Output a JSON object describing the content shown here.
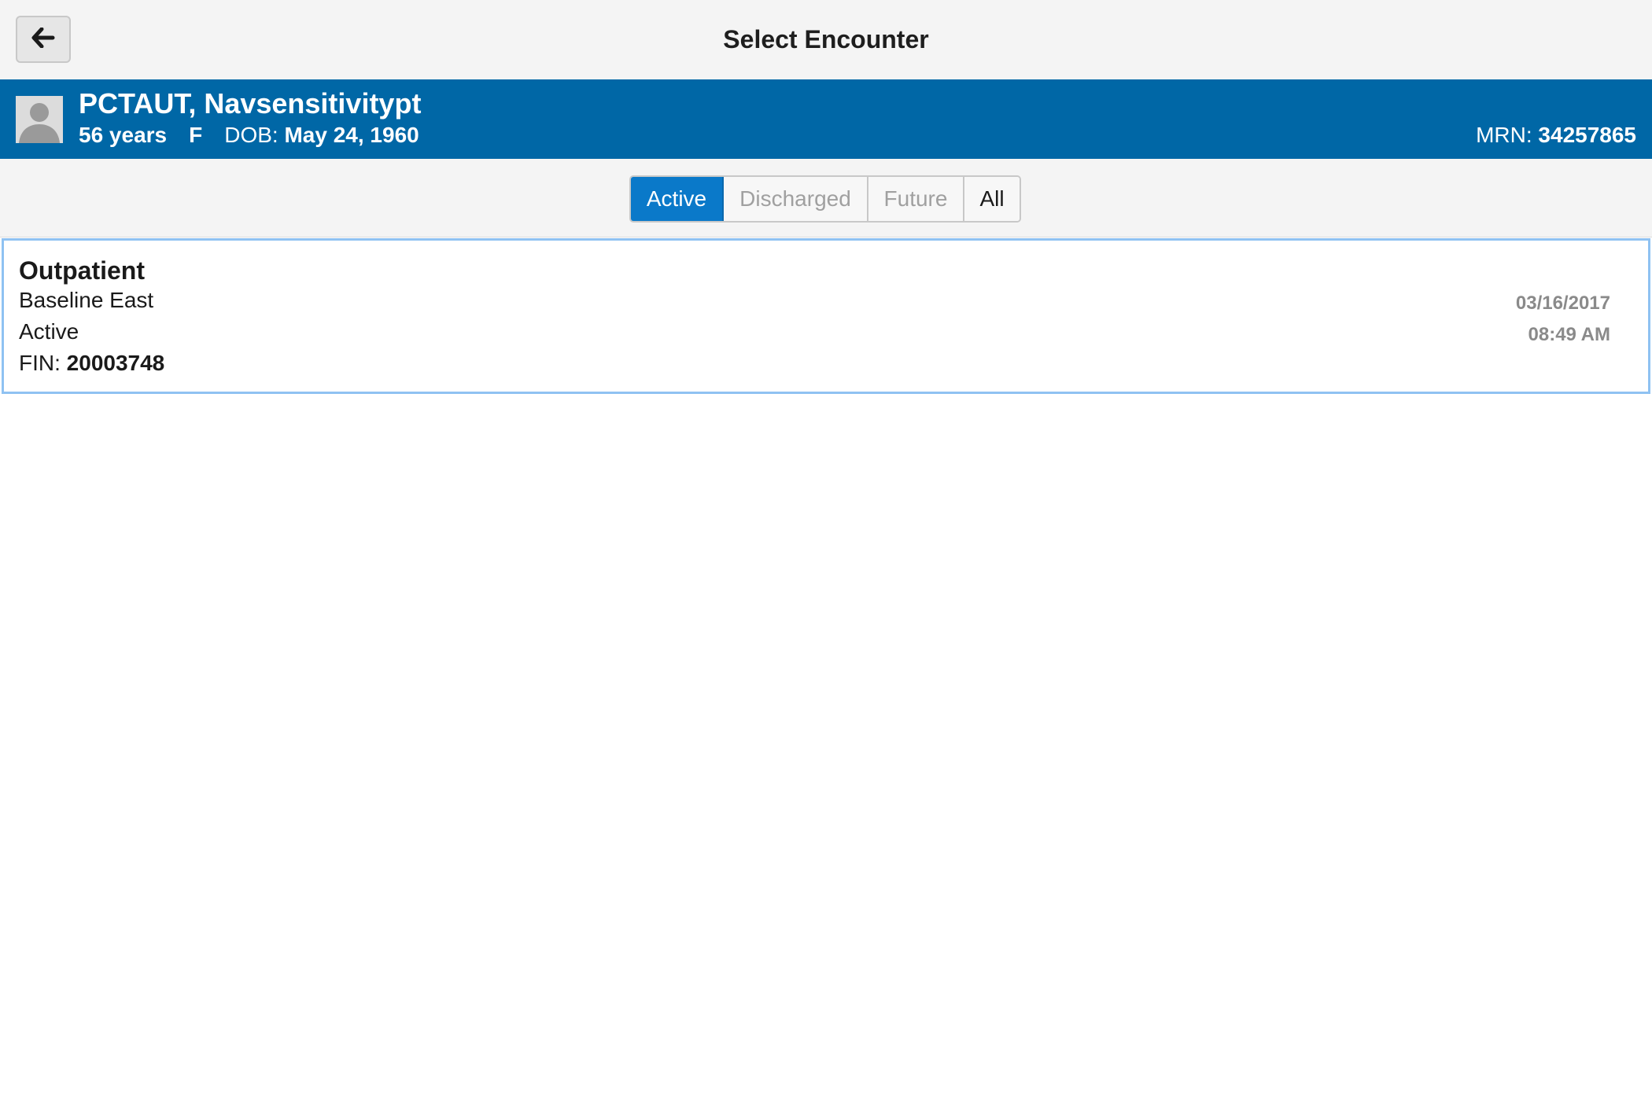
{
  "header": {
    "title": "Select Encounter",
    "back_icon": "arrow-left-icon"
  },
  "patient": {
    "name": "PCTAUT, Navsensitivitypt",
    "age": "56 years",
    "sex": "F",
    "dob_label": "DOB:",
    "dob": "May 24, 1960",
    "mrn_label": "MRN:",
    "mrn": "34257865",
    "avatar_icon": "person-silhouette-icon"
  },
  "filters": {
    "tabs": [
      {
        "label": "Active",
        "selected": true
      },
      {
        "label": "Discharged",
        "selected": false
      },
      {
        "label": "Future",
        "selected": false
      },
      {
        "label": "All",
        "selected": false
      }
    ]
  },
  "encounters": [
    {
      "type": "Outpatient",
      "location": "Baseline East",
      "status": "Active",
      "fin_label": "FIN:",
      "fin": "20003748",
      "date": "03/16/2017",
      "time": "08:49 AM"
    }
  ],
  "colors": {
    "banner": "#0067a6",
    "accent": "#0a79c9",
    "selection_border": "#8fc2f2"
  }
}
